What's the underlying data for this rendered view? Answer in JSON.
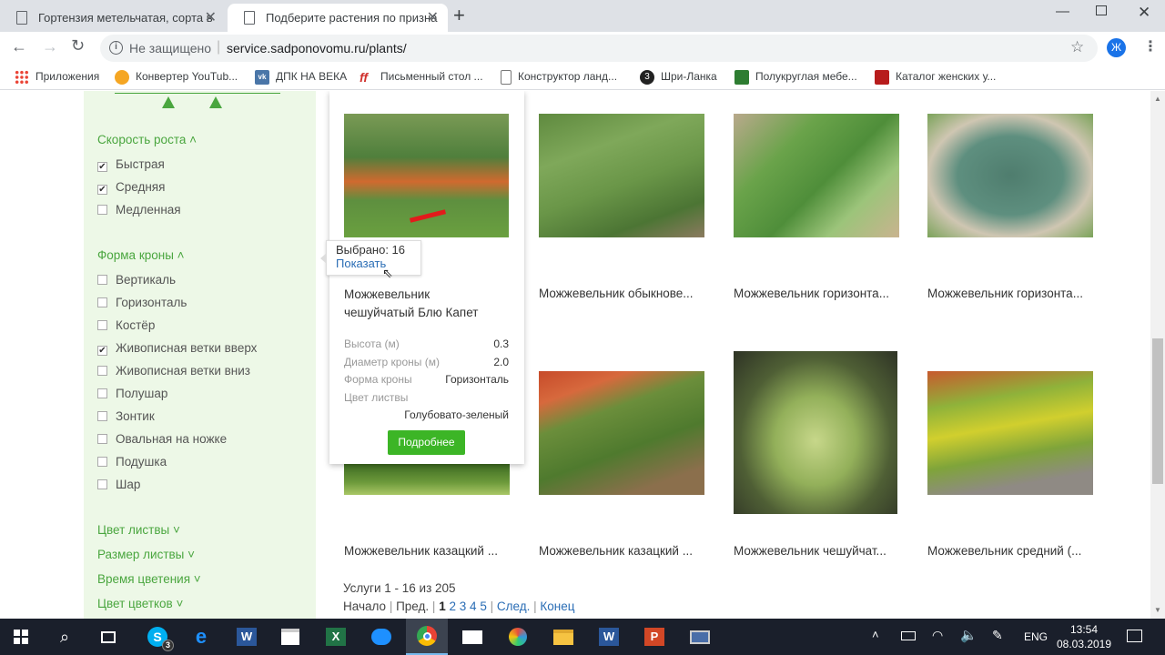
{
  "browser": {
    "tabs": [
      {
        "title": "Гортензия метельчатая, сорта в"
      },
      {
        "title": "Подберите растения по призна"
      }
    ],
    "url_security": "Не защищено",
    "url": "service.sadponovomu.ru/plants/",
    "profile_letter": "Ж",
    "bookmarks": [
      {
        "label": "Приложения",
        "icon": "apps-grid-icon",
        "color": "#ea4335"
      },
      {
        "label": "Конвертер YouTub...",
        "icon": "paw-icon",
        "color": "#f5a623"
      },
      {
        "label": "ДПК НА ВЕКА",
        "icon": "vk-icon",
        "color": "#4a76a8"
      },
      {
        "label": "Письменный стол ...",
        "icon": "ff-logo-icon",
        "color": "#d0312d"
      },
      {
        "label": "Конструктор ланд...",
        "icon": "document-icon",
        "color": "#888888"
      },
      {
        "label": "Шри-Ланка",
        "icon": "number-3-icon",
        "color": "#222222"
      },
      {
        "label": "Полукруглая мебе...",
        "icon": "green-square-icon",
        "color": "#2e7d32"
      },
      {
        "label": "Каталог женских у...",
        "icon": "red-square-icon",
        "color": "#b71c1c"
      }
    ]
  },
  "sidebar": {
    "sections": [
      {
        "title": "Скорость роста",
        "expanded": true,
        "items": [
          {
            "label": "Быстрая",
            "checked": true
          },
          {
            "label": "Средняя",
            "checked": true
          },
          {
            "label": "Медленная",
            "checked": false
          }
        ]
      },
      {
        "title": "Форма кроны",
        "expanded": true,
        "items": [
          {
            "label": "Вертикаль",
            "checked": false
          },
          {
            "label": "Горизонталь",
            "checked": false
          },
          {
            "label": "Костёр",
            "checked": false
          },
          {
            "label": "Живописная ветки вверх",
            "checked": true
          },
          {
            "label": "Живописная ветки вниз",
            "checked": false
          },
          {
            "label": "Полушар",
            "checked": false
          },
          {
            "label": "Зонтик",
            "checked": false
          },
          {
            "label": "Овальная на ножке",
            "checked": false
          },
          {
            "label": "Подушка",
            "checked": false
          },
          {
            "label": "Шар",
            "checked": false
          }
        ]
      }
    ],
    "collapsed": [
      {
        "title": "Цвет листвы"
      },
      {
        "title": "Размер листвы"
      },
      {
        "title": "Время цветения"
      },
      {
        "title": "Цвет цветков"
      }
    ]
  },
  "tooltip": {
    "selected_text": "Выбрано: 16",
    "show_link": "Показать"
  },
  "popup": {
    "name": [
      "Можжевельник",
      "чешуйчатый Блю Капет"
    ],
    "props": [
      {
        "label": "Высота (м)",
        "value": "0.3"
      },
      {
        "label": "Диаметр кроны (м)",
        "value": "2.0"
      },
      {
        "label": "Форма кроны",
        "value": "Горизонталь"
      },
      {
        "label": "Цвет листвы",
        "value": "Голубовато-зеленый"
      }
    ],
    "more_button": "Подробнее"
  },
  "products": [
    {
      "name": "Можжевельник обыкнове..."
    },
    {
      "name": "Можжевельник горизонта..."
    },
    {
      "name": "Можжевельник горизонта..."
    },
    {
      "name": "Можжевельник казацкий ..."
    },
    {
      "name": "Можжевельник казацкий ..."
    },
    {
      "name": "Можжевельник чешуйчат..."
    },
    {
      "name": "Можжевельник средний (..."
    }
  ],
  "pagination": {
    "summary": "Услуги 1 - 16 из 205",
    "start": "Начало",
    "prev": "Пред.",
    "pages": [
      "1",
      "2",
      "3",
      "4",
      "5"
    ],
    "current_page": "1",
    "next": "След.",
    "end": "Конец",
    "sep": "|"
  },
  "taskbar": {
    "lang": "ENG",
    "time": "13:54",
    "date": "08.03.2019",
    "skype_badge": "3"
  },
  "colors": {
    "accent_green": "#4aa63f",
    "button_green": "#3cb526",
    "link_blue": "#2a6db5"
  }
}
